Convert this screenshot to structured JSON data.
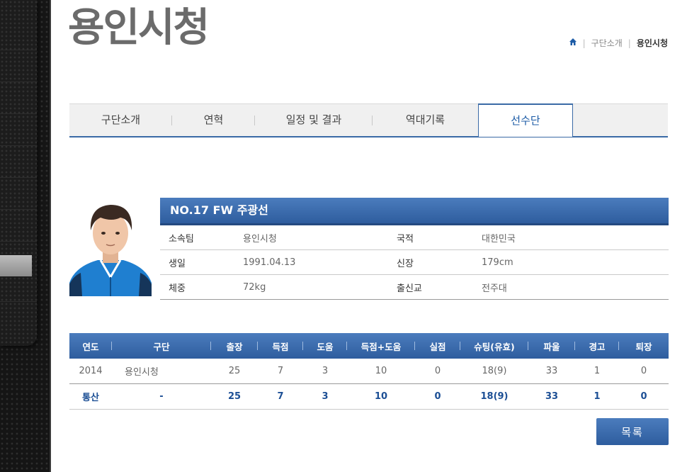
{
  "page": {
    "title": "용인시청"
  },
  "breadcrumb": {
    "items": [
      "구단소개",
      "용인시청"
    ]
  },
  "tabs": [
    "구단소개",
    "연혁",
    "일정 및 결과",
    "역대기록",
    "선수단"
  ],
  "active_tab": "선수단",
  "player": {
    "header": "NO.17 FW 주광선",
    "rows": [
      {
        "l1": "소속팀",
        "v1": "용인시청",
        "l2": "국적",
        "v2": "대한민국"
      },
      {
        "l1": "생일",
        "v1": "1991.04.13",
        "l2": "신장",
        "v2": "179cm"
      },
      {
        "l1": "체중",
        "v1": "72kg",
        "l2": "출신교",
        "v2": "전주대"
      }
    ]
  },
  "stats": {
    "headers": [
      "연도",
      "구단",
      "출장",
      "득점",
      "도움",
      "득점+도움",
      "실점",
      "슈팅(유효)",
      "파울",
      "경고",
      "퇴장"
    ],
    "rows": [
      [
        "2014",
        "용인시청",
        "25",
        "7",
        "3",
        "10",
        "0",
        "18(9)",
        "33",
        "1",
        "0"
      ],
      [
        "통산",
        "-",
        "25",
        "7",
        "3",
        "10",
        "0",
        "18(9)",
        "33",
        "1",
        "0"
      ]
    ]
  },
  "list_button": "목록",
  "colors": {
    "accent": "#2e5d9e",
    "accent_light": "#4b7cbd",
    "text_blue": "#1c4f95"
  }
}
